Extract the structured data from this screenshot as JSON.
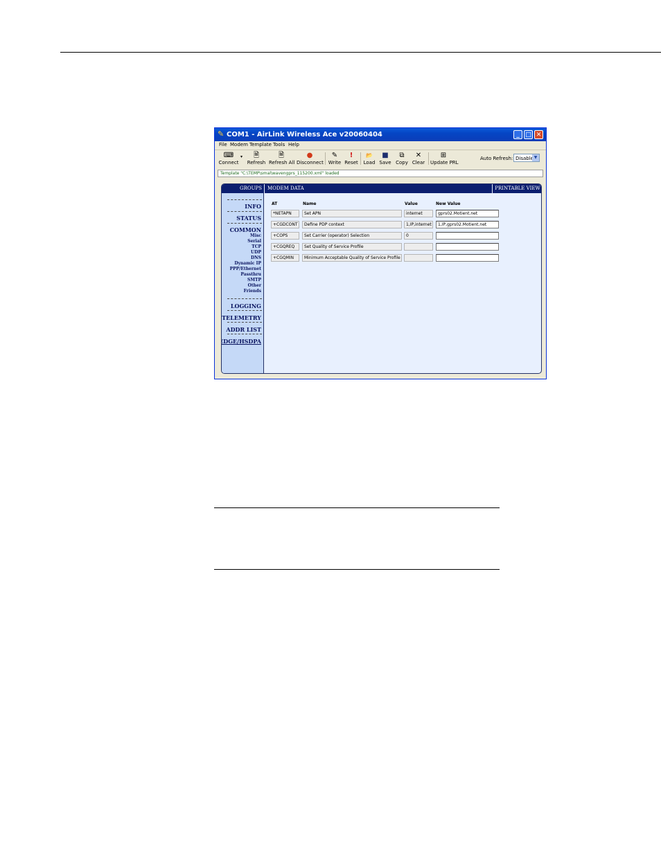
{
  "window": {
    "title": "COM1 - AirLink Wireless Ace v20060404",
    "buttons": {
      "minimize": "_",
      "maximize": "□",
      "close": "✕"
    }
  },
  "menu": [
    "File",
    "Modem",
    "Template",
    "Tools",
    "Help"
  ],
  "toolbar": [
    {
      "label": "Connect",
      "icon": "connect-icon",
      "glyph": "⌨"
    },
    {
      "label": "Refresh",
      "icon": "refresh-icon",
      "glyph": "🗎"
    },
    {
      "label": "Refresh All",
      "icon": "refresh-all-icon",
      "glyph": "🗎"
    },
    {
      "label": "Disconnect",
      "icon": "disconnect-icon",
      "glyph": "●"
    },
    {
      "label": "Write",
      "icon": "pencil-icon",
      "glyph": "✎"
    },
    {
      "label": "Reset",
      "icon": "exclamation-icon",
      "glyph": "!"
    },
    {
      "label": "Load",
      "icon": "folder-icon",
      "glyph": "📂"
    },
    {
      "label": "Save",
      "icon": "disk-icon",
      "glyph": "■"
    },
    {
      "label": "Copy",
      "icon": "copy-icon",
      "glyph": "⧉"
    },
    {
      "label": "Clear",
      "icon": "x-icon",
      "glyph": "✕"
    },
    {
      "label": "Update PRL",
      "icon": "update-prl-icon",
      "glyph": "⊞"
    }
  ],
  "auto_refresh": {
    "label": "Auto Refresh:",
    "value": "Disabled"
  },
  "status": "Template \"C:\\TEMP\\smal\\wavengprs_115200.xml\" loaded",
  "panel": {
    "groups_header": "GROUPS",
    "modem_header": "MODEM DATA",
    "print_header": "PRINTABLE VIEW"
  },
  "sidebar": {
    "info": "INFO",
    "status": "STATUS",
    "common": "COMMON",
    "common_items": [
      "Misc",
      "Serial",
      "TCP",
      "UDP",
      "DNS",
      "Dynamic IP",
      "PPP/Ethernet",
      "Passthru",
      "SMTP",
      "Other",
      "Friends"
    ],
    "logging": "LOGGING",
    "telemetry": "TELEMETRY",
    "addr_list": "ADDR LIST",
    "edge": "EDGE/HSDPA"
  },
  "table": {
    "headers": {
      "at": "AT",
      "name": "Name",
      "value": "Value",
      "new_value": "New Value"
    },
    "rows": [
      {
        "at": "*NETAPN",
        "name": "Set APN",
        "value": "internet",
        "new_value": "gprs02.Motient.net"
      },
      {
        "at": "+CGDCONT",
        "name": "Define PDP context",
        "value": "1,IP,internet",
        "new_value": "1,IP,gprs02.Motient.net"
      },
      {
        "at": "+COPS",
        "name": "Set Carrier (operator) Selection",
        "value": "0",
        "new_value": ""
      },
      {
        "at": "+CGQREQ",
        "name": "Set Quality of Service Profile",
        "value": "",
        "new_value": ""
      },
      {
        "at": "+CGQMIN",
        "name": "Minimum Acceptable Quality of Service Profile",
        "value": "",
        "new_value": ""
      }
    ]
  }
}
